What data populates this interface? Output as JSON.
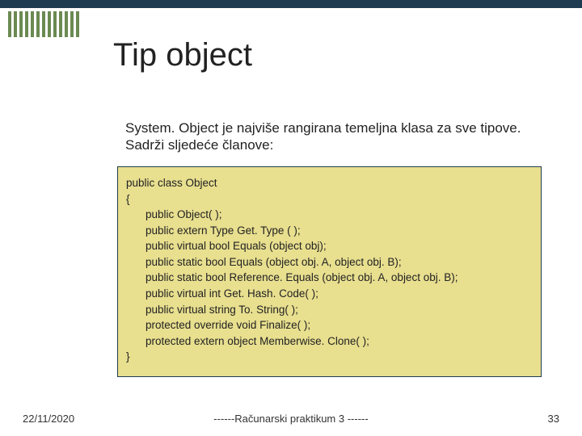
{
  "title": "Tip object",
  "description": "System. Object je najviše rangirana temeljna klasa za sve tipove. Sadrži sljedeće članove:",
  "code": {
    "l1": "public class Object",
    "l2": "{",
    "m1": "public Object( );",
    "m2": "public extern Type Get. Type ( );",
    "m3": "public virtual bool Equals (object obj);",
    "m4": "public static bool Equals (object obj. A, object obj. B);",
    "m5": "public static bool Reference. Equals (object obj. A, object obj. B);",
    "m6": "public virtual int Get. Hash. Code( );",
    "m7": "public virtual string To. String( );",
    "m8": "protected override void Finalize( );",
    "m9": "protected extern object Memberwise. Clone( );",
    "l3": "}"
  },
  "footer": {
    "date": "22/11/2020",
    "center": "------Računarski praktikum 3 ------",
    "page": "33"
  }
}
